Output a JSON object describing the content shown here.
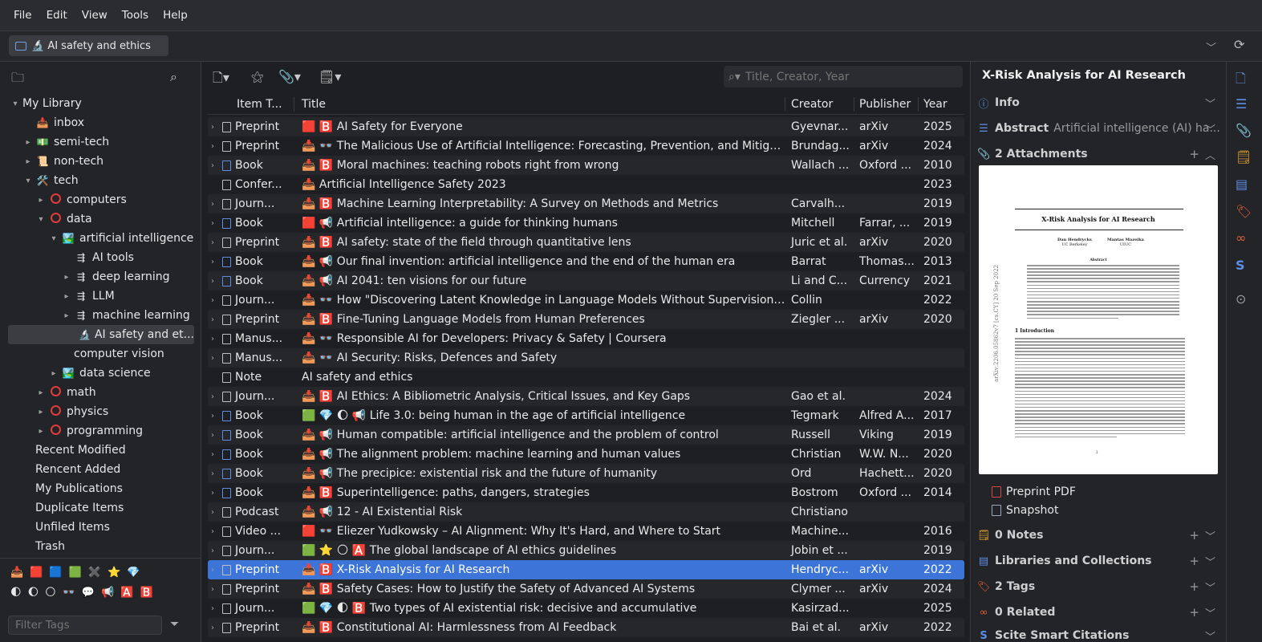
{
  "menu": [
    "File",
    "Edit",
    "View",
    "Tools",
    "Help"
  ],
  "tab": {
    "label": "🔬 AI safety and ethics"
  },
  "tree": [
    {
      "label": "My Library",
      "indent": 0,
      "twisty": "▾",
      "icon": ""
    },
    {
      "label": "inbox",
      "indent": 1,
      "twisty": "",
      "icon": "📥"
    },
    {
      "label": "semi-tech",
      "indent": 1,
      "twisty": "▸",
      "icon": "💵"
    },
    {
      "label": "non-tech",
      "indent": 1,
      "twisty": "▸",
      "icon": "📜"
    },
    {
      "label": "tech",
      "indent": 1,
      "twisty": "▾",
      "icon": "🛠️"
    },
    {
      "label": "computers",
      "indent": 2,
      "twisty": "▸",
      "icon": "ring"
    },
    {
      "label": "data",
      "indent": 2,
      "twisty": "▾",
      "icon": "ring"
    },
    {
      "label": "artificial intelligence",
      "indent": 3,
      "twisty": "▾",
      "icon": "🏞️"
    },
    {
      "label": "AI tools",
      "indent": 4,
      "twisty": "",
      "icon": "⇶"
    },
    {
      "label": "deep learning",
      "indent": 4,
      "twisty": "▸",
      "icon": "⇶"
    },
    {
      "label": "LLM",
      "indent": 4,
      "twisty": "▸",
      "icon": "⇶"
    },
    {
      "label": "machine learning",
      "indent": 4,
      "twisty": "▸",
      "icon": "⇶"
    },
    {
      "label": "AI safety and et...",
      "indent": 5,
      "twisty": "",
      "icon": "🔬",
      "selected": true
    },
    {
      "label": "computer vision",
      "indent": 4,
      "twisty": "",
      "icon": ""
    },
    {
      "label": "data science",
      "indent": 3,
      "twisty": "▸",
      "icon": "🏞️"
    },
    {
      "label": "math",
      "indent": 2,
      "twisty": "▸",
      "icon": "ring"
    },
    {
      "label": "physics",
      "indent": 2,
      "twisty": "▸",
      "icon": "ring"
    },
    {
      "label": "programming",
      "indent": 2,
      "twisty": "▸",
      "icon": "ring"
    },
    {
      "label": "Recent Modified",
      "indent": 1,
      "twisty": "",
      "icon": ""
    },
    {
      "label": "Rencent Added",
      "indent": 1,
      "twisty": "",
      "icon": ""
    },
    {
      "label": "My Publications",
      "indent": 1,
      "twisty": "",
      "icon": ""
    },
    {
      "label": "Duplicate Items",
      "indent": 1,
      "twisty": "",
      "icon": ""
    },
    {
      "label": "Unfiled Items",
      "indent": 1,
      "twisty": "",
      "icon": ""
    },
    {
      "label": "Trash",
      "indent": 1,
      "twisty": "",
      "icon": ""
    }
  ],
  "tags_row1": [
    "📥",
    "🟥",
    "🟦",
    "🟩",
    "✖️",
    "⭐",
    "💎"
  ],
  "tags_row2": [
    "🌓",
    "🌔",
    "🌕",
    "👓",
    "💬",
    "📢",
    "🅰️",
    "🅱️"
  ],
  "filter_tags_placeholder": "Filter Tags",
  "search_placeholder": "Title, Creator, Year",
  "columns": {
    "type": "Item T...",
    "title": "Title",
    "creator": "Creator",
    "publisher": "Publisher",
    "year": "Year"
  },
  "items": [
    {
      "type": "Preprint",
      "kind": "doc",
      "title": "🟥 🅱️ AI Safety for Everyone",
      "creator": "Gyevnar...",
      "publisher": "arXiv",
      "year": "2025"
    },
    {
      "type": "Preprint",
      "kind": "doc",
      "title": "📥 👓 The Malicious Use of Artificial Intelligence: Forecasting, Prevention, and Mitigation",
      "creator": "Brundag...",
      "publisher": "arXiv",
      "year": "2024"
    },
    {
      "type": "Book",
      "kind": "book",
      "title": "📥 🅱️ Moral machines: teaching robots right from wrong",
      "creator": "Wallach ...",
      "publisher": "Oxford ...",
      "year": "2010"
    },
    {
      "type": "Confer...",
      "kind": "conf",
      "title": "📥 Artificial Intelligence Safety 2023",
      "creator": "",
      "publisher": "",
      "year": "2023"
    },
    {
      "type": "Journ...",
      "kind": "doc",
      "title": "📥 🅱️ Machine Learning Interpretability: A Survey on Methods and Metrics",
      "creator": "Carvalh...",
      "publisher": "",
      "year": "2019"
    },
    {
      "type": "Book",
      "kind": "book",
      "title": "🟥 📢 Artificial intelligence: a guide for thinking humans",
      "creator": "Mitchell",
      "publisher": "Farrar, ...",
      "year": "2019"
    },
    {
      "type": "Preprint",
      "kind": "doc",
      "title": "📥 🅱️ AI safety: state of the field through quantitative lens",
      "creator": "Juric et al.",
      "publisher": "arXiv",
      "year": "2020"
    },
    {
      "type": "Book",
      "kind": "book",
      "title": "📥 📢 Our final invention: artificial intelligence and the end of the human era",
      "creator": "Barrat",
      "publisher": "Thomas...",
      "year": "2013"
    },
    {
      "type": "Book",
      "kind": "book",
      "title": "📥 📢 AI 2041: ten visions for our future",
      "creator": "Li and C...",
      "publisher": "Currency",
      "year": "2021"
    },
    {
      "type": "Journ...",
      "kind": "doc",
      "title": "📥 👓 How \"Discovering Latent Knowledge in Language Models Without Supervision\" Fi...",
      "creator": "Collin",
      "publisher": "",
      "year": "2022"
    },
    {
      "type": "Preprint",
      "kind": "doc",
      "title": "📥 🅱️ Fine-Tuning Language Models from Human Preferences",
      "creator": "Ziegler ...",
      "publisher": "arXiv",
      "year": "2020"
    },
    {
      "type": "Manus...",
      "kind": "doc",
      "title": "📥 👓 Responsible AI for Developers: Privacy & Safety | Coursera",
      "creator": "",
      "publisher": "",
      "year": ""
    },
    {
      "type": "Manus...",
      "kind": "doc",
      "title": "📥 👓 AI Security: Risks, Defences and Safety",
      "creator": "",
      "publisher": "",
      "year": ""
    },
    {
      "type": "Note",
      "kind": "note",
      "title": "AI safety and ethics",
      "creator": "",
      "publisher": "",
      "year": ""
    },
    {
      "type": "Journ...",
      "kind": "doc",
      "title": "📥 🅱️ AI Ethics: A Bibliometric Analysis, Critical Issues, and Key Gaps",
      "creator": "Gao et al.",
      "publisher": "",
      "year": "2024"
    },
    {
      "type": "Book",
      "kind": "book",
      "title": "🟩 💎 🌔 📢 Life 3.0: being human in the age of artificial intelligence",
      "creator": "Tegmark",
      "publisher": "Alfred A...",
      "year": "2017"
    },
    {
      "type": "Book",
      "kind": "book",
      "title": "📥 📢 Human compatible: artificial intelligence and the problem of control",
      "creator": "Russell",
      "publisher": "Viking",
      "year": "2019"
    },
    {
      "type": "Book",
      "kind": "book",
      "title": "📥 📢 The alignment problem: machine learning and human values",
      "creator": "Christian",
      "publisher": "W.W. N...",
      "year": "2020"
    },
    {
      "type": "Book",
      "kind": "book",
      "title": "📥 📢 The precipice: existential risk and the future of humanity",
      "creator": "Ord",
      "publisher": "Hachett...",
      "year": "2020"
    },
    {
      "type": "Book",
      "kind": "book",
      "title": "📥 🅱️ Superintelligence: paths, dangers, strategies",
      "creator": "Bostrom",
      "publisher": "Oxford ...",
      "year": "2014"
    },
    {
      "type": "Podcast",
      "kind": "pod",
      "title": "📥 📢 12 - AI Existential Risk",
      "creator": "Christiano",
      "publisher": "",
      "year": ""
    },
    {
      "type": "Video ...",
      "kind": "video",
      "title": "🟥 👓 Eliezer Yudkowsky – AI Alignment: Why It's Hard, and Where to Start",
      "creator": "Machine...",
      "publisher": "",
      "year": "2016"
    },
    {
      "type": "Journ...",
      "kind": "doc",
      "title": "🟩 ⭐ 🌕 🅰️ The global landscape of AI ethics guidelines",
      "creator": "Jobin et ...",
      "publisher": "",
      "year": "2019"
    },
    {
      "type": "Preprint",
      "kind": "doc",
      "title": "📥 🅱️ X-Risk Analysis for AI Research",
      "creator": "Hendryc...",
      "publisher": "arXiv",
      "year": "2022",
      "selected": true
    },
    {
      "type": "Preprint",
      "kind": "doc",
      "title": "📥 🅱️ Safety Cases: How to Justify the Safety of Advanced AI Systems",
      "creator": "Clymer ...",
      "publisher": "arXiv",
      "year": "2024"
    },
    {
      "type": "Journ...",
      "kind": "doc",
      "title": "🟩 💎 🌓 🅱️ Two types of AI existential risk: decisive and accumulative",
      "creator": "Kasirzad...",
      "publisher": "",
      "year": "2025"
    },
    {
      "type": "Preprint",
      "kind": "doc",
      "title": "📥 🅱️ Constitutional AI: Harmlessness from AI Feedback",
      "creator": "Bai et al.",
      "publisher": "arXiv",
      "year": "2022"
    }
  ],
  "item_pane": {
    "title": "X-Risk Analysis for AI Research",
    "info": "Info",
    "abstract_label": "Abstract",
    "abstract_text": "Artificial intelligence (AI) ha...",
    "attachments_label": "2 Attachments",
    "preview": {
      "paper_title": "X-Risk Analysis for AI Research",
      "author1": "Dan Hendrycks",
      "affil1": "UC Berkeley",
      "author2": "Mantas Mazeika",
      "affil2": "UIUC",
      "abstract_heading": "Abstract",
      "section": "1   Introduction",
      "arxiv_id": "arXiv:2206.05862v7  [cs.CY]  20 Sep 2022",
      "page_number": "1"
    },
    "attachments": [
      "Preprint PDF",
      "Snapshot"
    ],
    "notes_label": "0 Notes",
    "libraries_label": "Libraries and Collections",
    "tags_label": "2 Tags",
    "related_label": "0 Related",
    "scite_label": "Scite Smart Citations"
  }
}
